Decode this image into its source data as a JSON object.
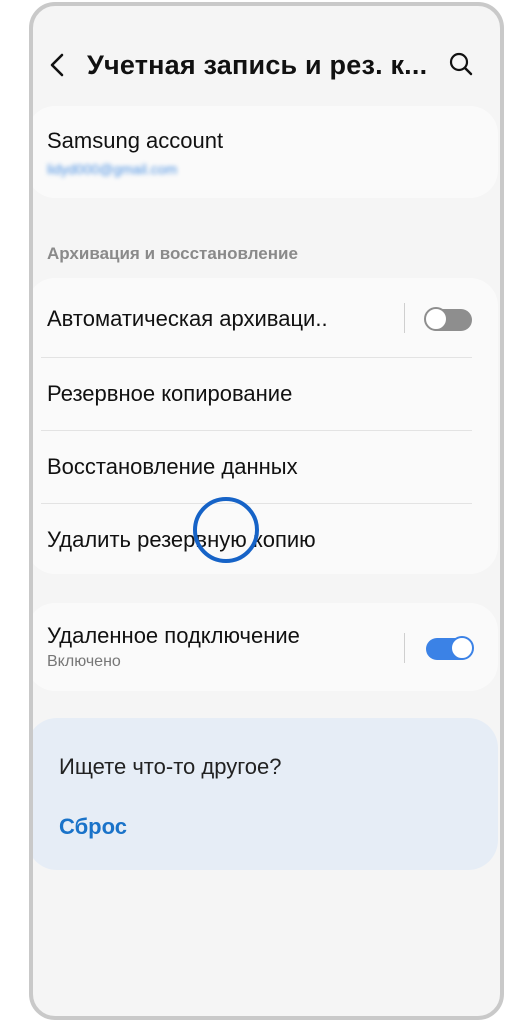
{
  "header": {
    "title": "Учетная запись и рез. к...",
    "back_icon": "chevron-left-icon",
    "search_icon": "search-icon"
  },
  "account": {
    "name": "Samsung account",
    "email": "lidyd000@gmail.com"
  },
  "backup_section": {
    "label": "Архивация и восстановление",
    "items": [
      {
        "label": "Автоматическая архиваци..",
        "toggle": "off"
      },
      {
        "label": "Резервное копирование"
      },
      {
        "label": "Восстановление данных"
      },
      {
        "label": "Удалить резервную копию"
      }
    ]
  },
  "remote": {
    "label": "Удаленное подключение",
    "status": "Включено",
    "toggle": "on"
  },
  "suggestion": {
    "title": "Ищете что-то другое?",
    "link": "Сброс"
  },
  "colors": {
    "accent": "#3b82e6",
    "link": "#1a73c9",
    "tap_indicator": "#1663c7",
    "suggestion_bg": "#e6edf6"
  }
}
